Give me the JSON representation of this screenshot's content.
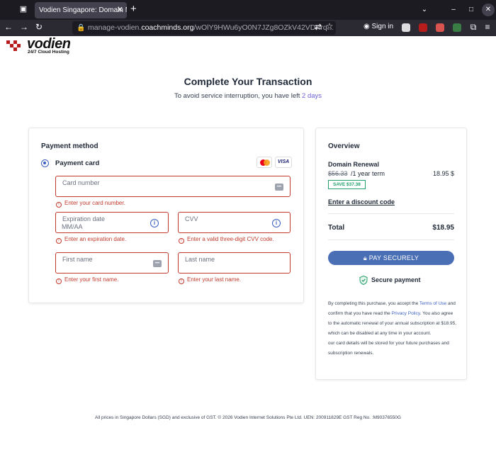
{
  "browser": {
    "tab_title": "Vodien Singapore: Domain N",
    "url_prefix": "manage-vodien.",
    "url_domain": "coachminds.org",
    "url_path": "/wOlY9HWu6yO0N7JZg8OZkV42VDKrq...",
    "sign_in": "Sign in"
  },
  "logo": {
    "name": "vodien",
    "tagline": "24/7 Cloud Hosting"
  },
  "header": {
    "title": "Complete Your Transaction",
    "subtitle_prefix": "To avoid service interruption, you have left",
    "days": "2 days"
  },
  "payment": {
    "section_title": "Payment method",
    "option_label": "Payment card",
    "card_brand": "VISA",
    "card_number_label": "Card number",
    "card_number_error": "Enter your card number.",
    "expiration_label": "Expiration date",
    "expiration_placeholder": "MM/AA",
    "expiration_error": "Enter an expiration date.",
    "cvv_label": "CVV",
    "cvv_error": "Enter a valid three-digit CVV code.",
    "first_name_label": "First name",
    "first_name_error": "Enter your first name.",
    "last_name_label": "Last name",
    "last_name_error": "Enter your last name."
  },
  "overview": {
    "section_title": "Overview",
    "item": "Domain Renewal",
    "old_price": "$56.33",
    "term": "/1 year term",
    "price": "18.95 $",
    "save_badge": "SAVE $37.38",
    "discount_link": "Enter a discount code",
    "total_label": "Total",
    "total_value": "$18.95",
    "pay_button": "PAY SECURELY",
    "secure_label": "Secure payment",
    "legal_1": "By completing this purchase, you accept the",
    "terms_link": "Terms of Use",
    "legal_2": "and confirm that you have read the",
    "privacy_link": "Privacy Policy",
    "legal_3": "You also agree to the automatic renewal of your annual subscription at $18.95, which can be disabled at any time in your account.",
    "legal_4": "our card details will be stored for your future purchases and subscription renewals."
  },
  "footer": "All prices in Singapore Dollars (SGD) and exclusive of GST. © 2026 Vodien Internet Solutions Pte Ltd. UEN: 200911829E GST Reg No. :M90376550G",
  "colors": {
    "accent": "#4a6fb5",
    "error": "#c0392b",
    "brand_red": "#b71c1c",
    "save_green": "#22a06b"
  }
}
